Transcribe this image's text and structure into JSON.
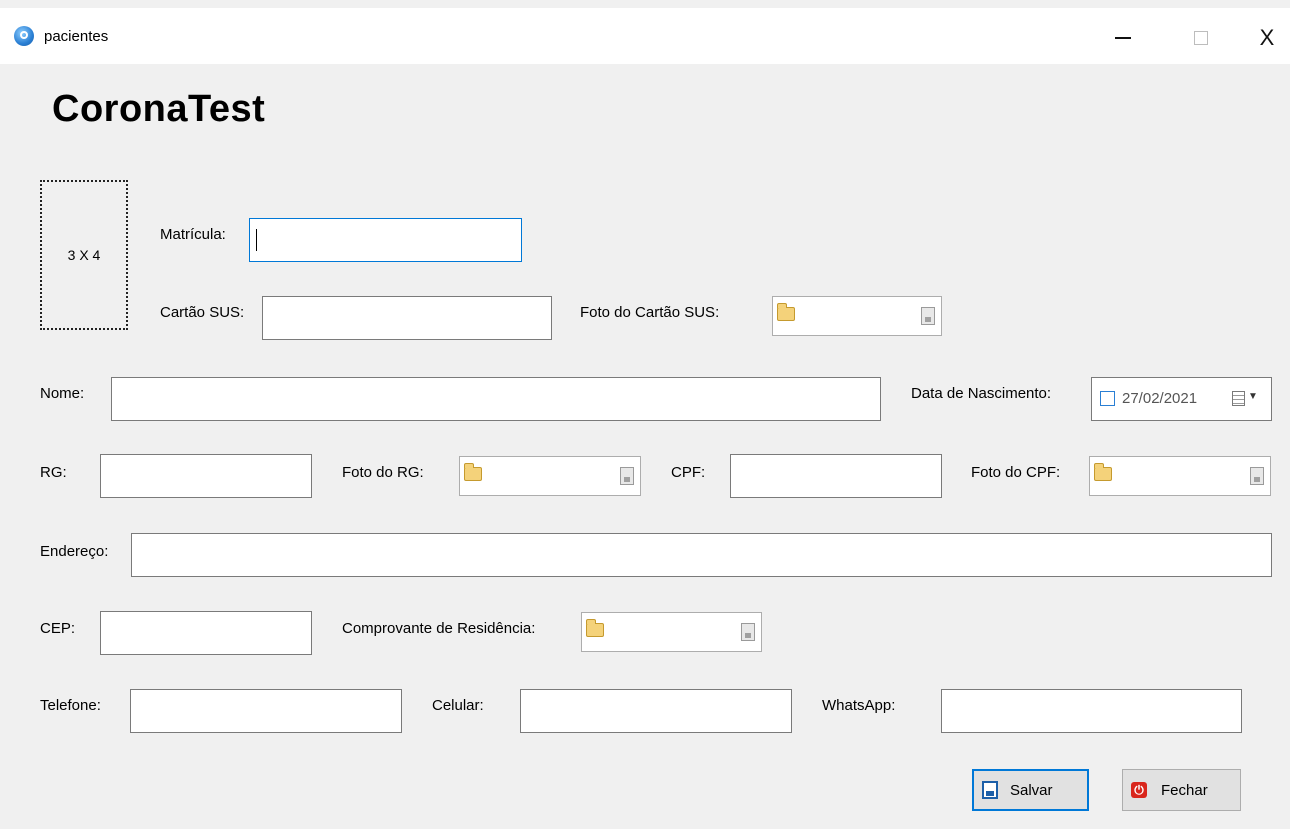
{
  "window": {
    "title": "pacientes",
    "minimize_glyph": "",
    "maximize_glyph": "",
    "close_glyph": "X"
  },
  "brand": "CoronaTest",
  "photo": "3 X 4",
  "labels": {
    "matricula": "Matrícula:",
    "cartao_sus": "Cartão SUS:",
    "foto_cartao_sus": "Foto do Cartão SUS:",
    "nome": "Nome:",
    "data_nascimento": "Data de Nascimento:",
    "rg": "RG:",
    "foto_rg": "Foto do RG:",
    "cpf": "CPF:",
    "foto_cpf": "Foto do CPF:",
    "endereco": "Endereço:",
    "cep": "CEP:",
    "comprovante": "Comprovante de Residência:",
    "telefone": "Telefone:",
    "celular": "Celular:",
    "whatsapp": "WhatsApp:"
  },
  "values": {
    "data_nascimento": "27/02/2021"
  },
  "buttons": {
    "salvar": "Salvar",
    "fechar": "Fechar"
  },
  "icons": {
    "folder": "folder-icon",
    "save": "save-icon",
    "calendar": "calendar-icon",
    "power": "power-icon"
  }
}
